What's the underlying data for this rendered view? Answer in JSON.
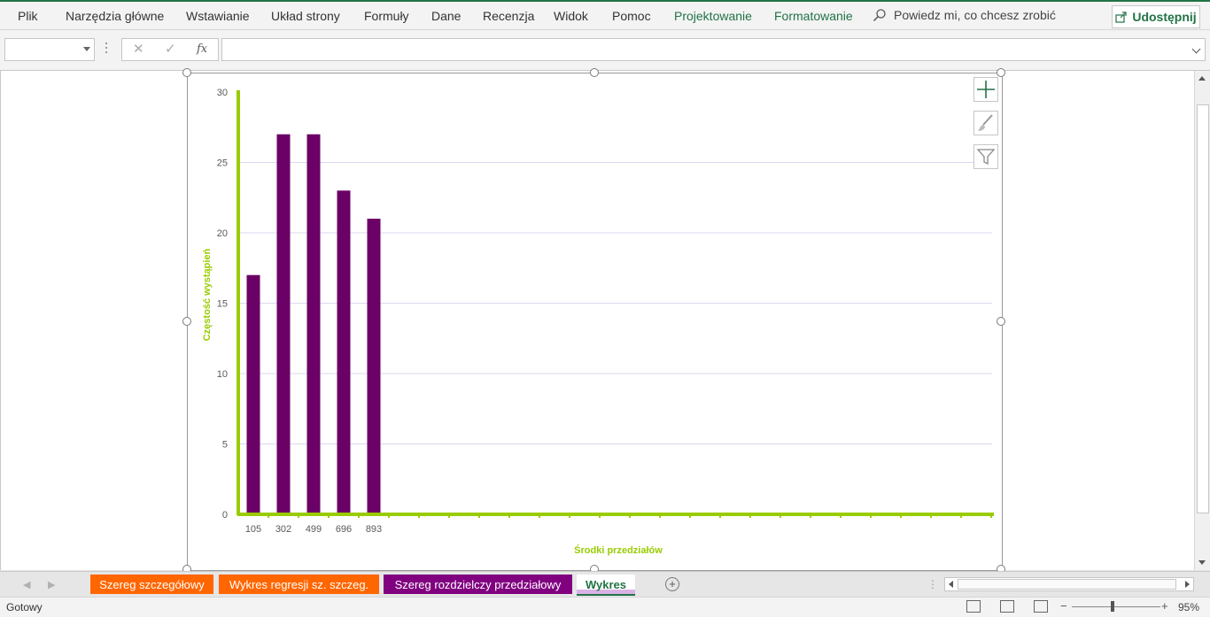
{
  "ribbon": {
    "tabs": [
      "Plik",
      "Narzędzia główne",
      "Wstawianie",
      "Układ strony",
      "Formuły",
      "Dane",
      "Recenzja",
      "Widok",
      "Pomoc",
      "Projektowanie",
      "Formatowanie"
    ],
    "tell_me": "Powiedz mi, co chcesz zrobić",
    "share": "Udostępnij"
  },
  "formula_bar": {
    "name_box": "",
    "formula": "",
    "fx": "fx"
  },
  "chart_data": {
    "type": "bar",
    "categories": [
      "105",
      "302",
      "499",
      "696",
      "893",
      "",
      "",
      "",
      "",
      "",
      "",
      "",
      "",
      "",
      "",
      "",
      "",
      "",
      "",
      "",
      "",
      "",
      "",
      "",
      "",
      ""
    ],
    "values": [
      17,
      27,
      27,
      23,
      21,
      null,
      null,
      null,
      null,
      null,
      null,
      null,
      null,
      null,
      null,
      null,
      null,
      null,
      null,
      null,
      null,
      null,
      null,
      null,
      null,
      null
    ],
    "xlabel": "Środki przedziałów",
    "ylabel": "Częstość wystąpień",
    "ylim": [
      0,
      30
    ],
    "yticks": [
      0,
      5,
      10,
      15,
      20,
      25,
      30
    ],
    "grid": true,
    "bar_color": "#6b0066",
    "axis_color": "#99cc00"
  },
  "sheets": [
    {
      "label": "Szereg szczegółowy",
      "color": "#ff6600"
    },
    {
      "label": "Wykres regresji sz. szczeg.",
      "color": "#ff6600"
    },
    {
      "label": "Szereg rozdzielczy przedziałowy",
      "color": "#800080"
    },
    {
      "label": "Wykres",
      "active": true
    }
  ],
  "status": {
    "ready": "Gotowy",
    "zoom": "95%"
  }
}
